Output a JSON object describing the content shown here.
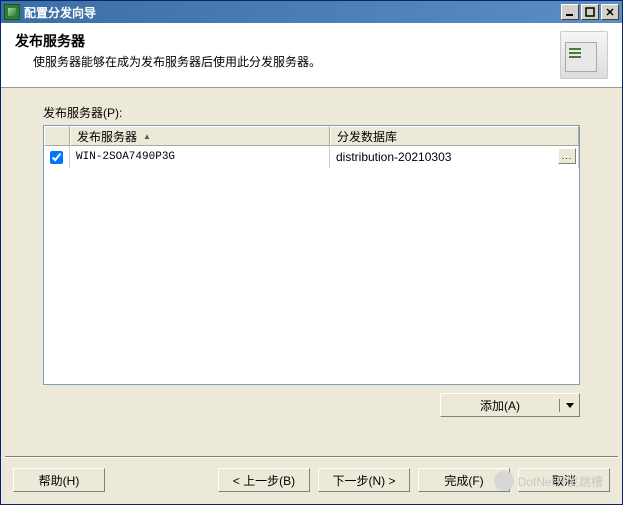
{
  "window": {
    "title": "配置分发向导"
  },
  "header": {
    "heading": "发布服务器",
    "description": "使服务器能够在成为发布服务器后使用此分发服务器。"
  },
  "section_label": "发布服务器(P):",
  "columns": {
    "col1": "发布服务器",
    "col2": "分发数据库"
  },
  "rows": [
    {
      "checked": true,
      "server": "WIN-2SOA7490P3G",
      "db": "distribution-20210303"
    }
  ],
  "buttons": {
    "add": "添加(A)",
    "help": "帮助(H)",
    "back": "< 上一步(B)",
    "next": "下一步(N) >",
    "finish": "完成(F)",
    "cancel": "取消"
  },
  "ellipsis": "...",
  "watermark": "DotNet开发跳槽"
}
